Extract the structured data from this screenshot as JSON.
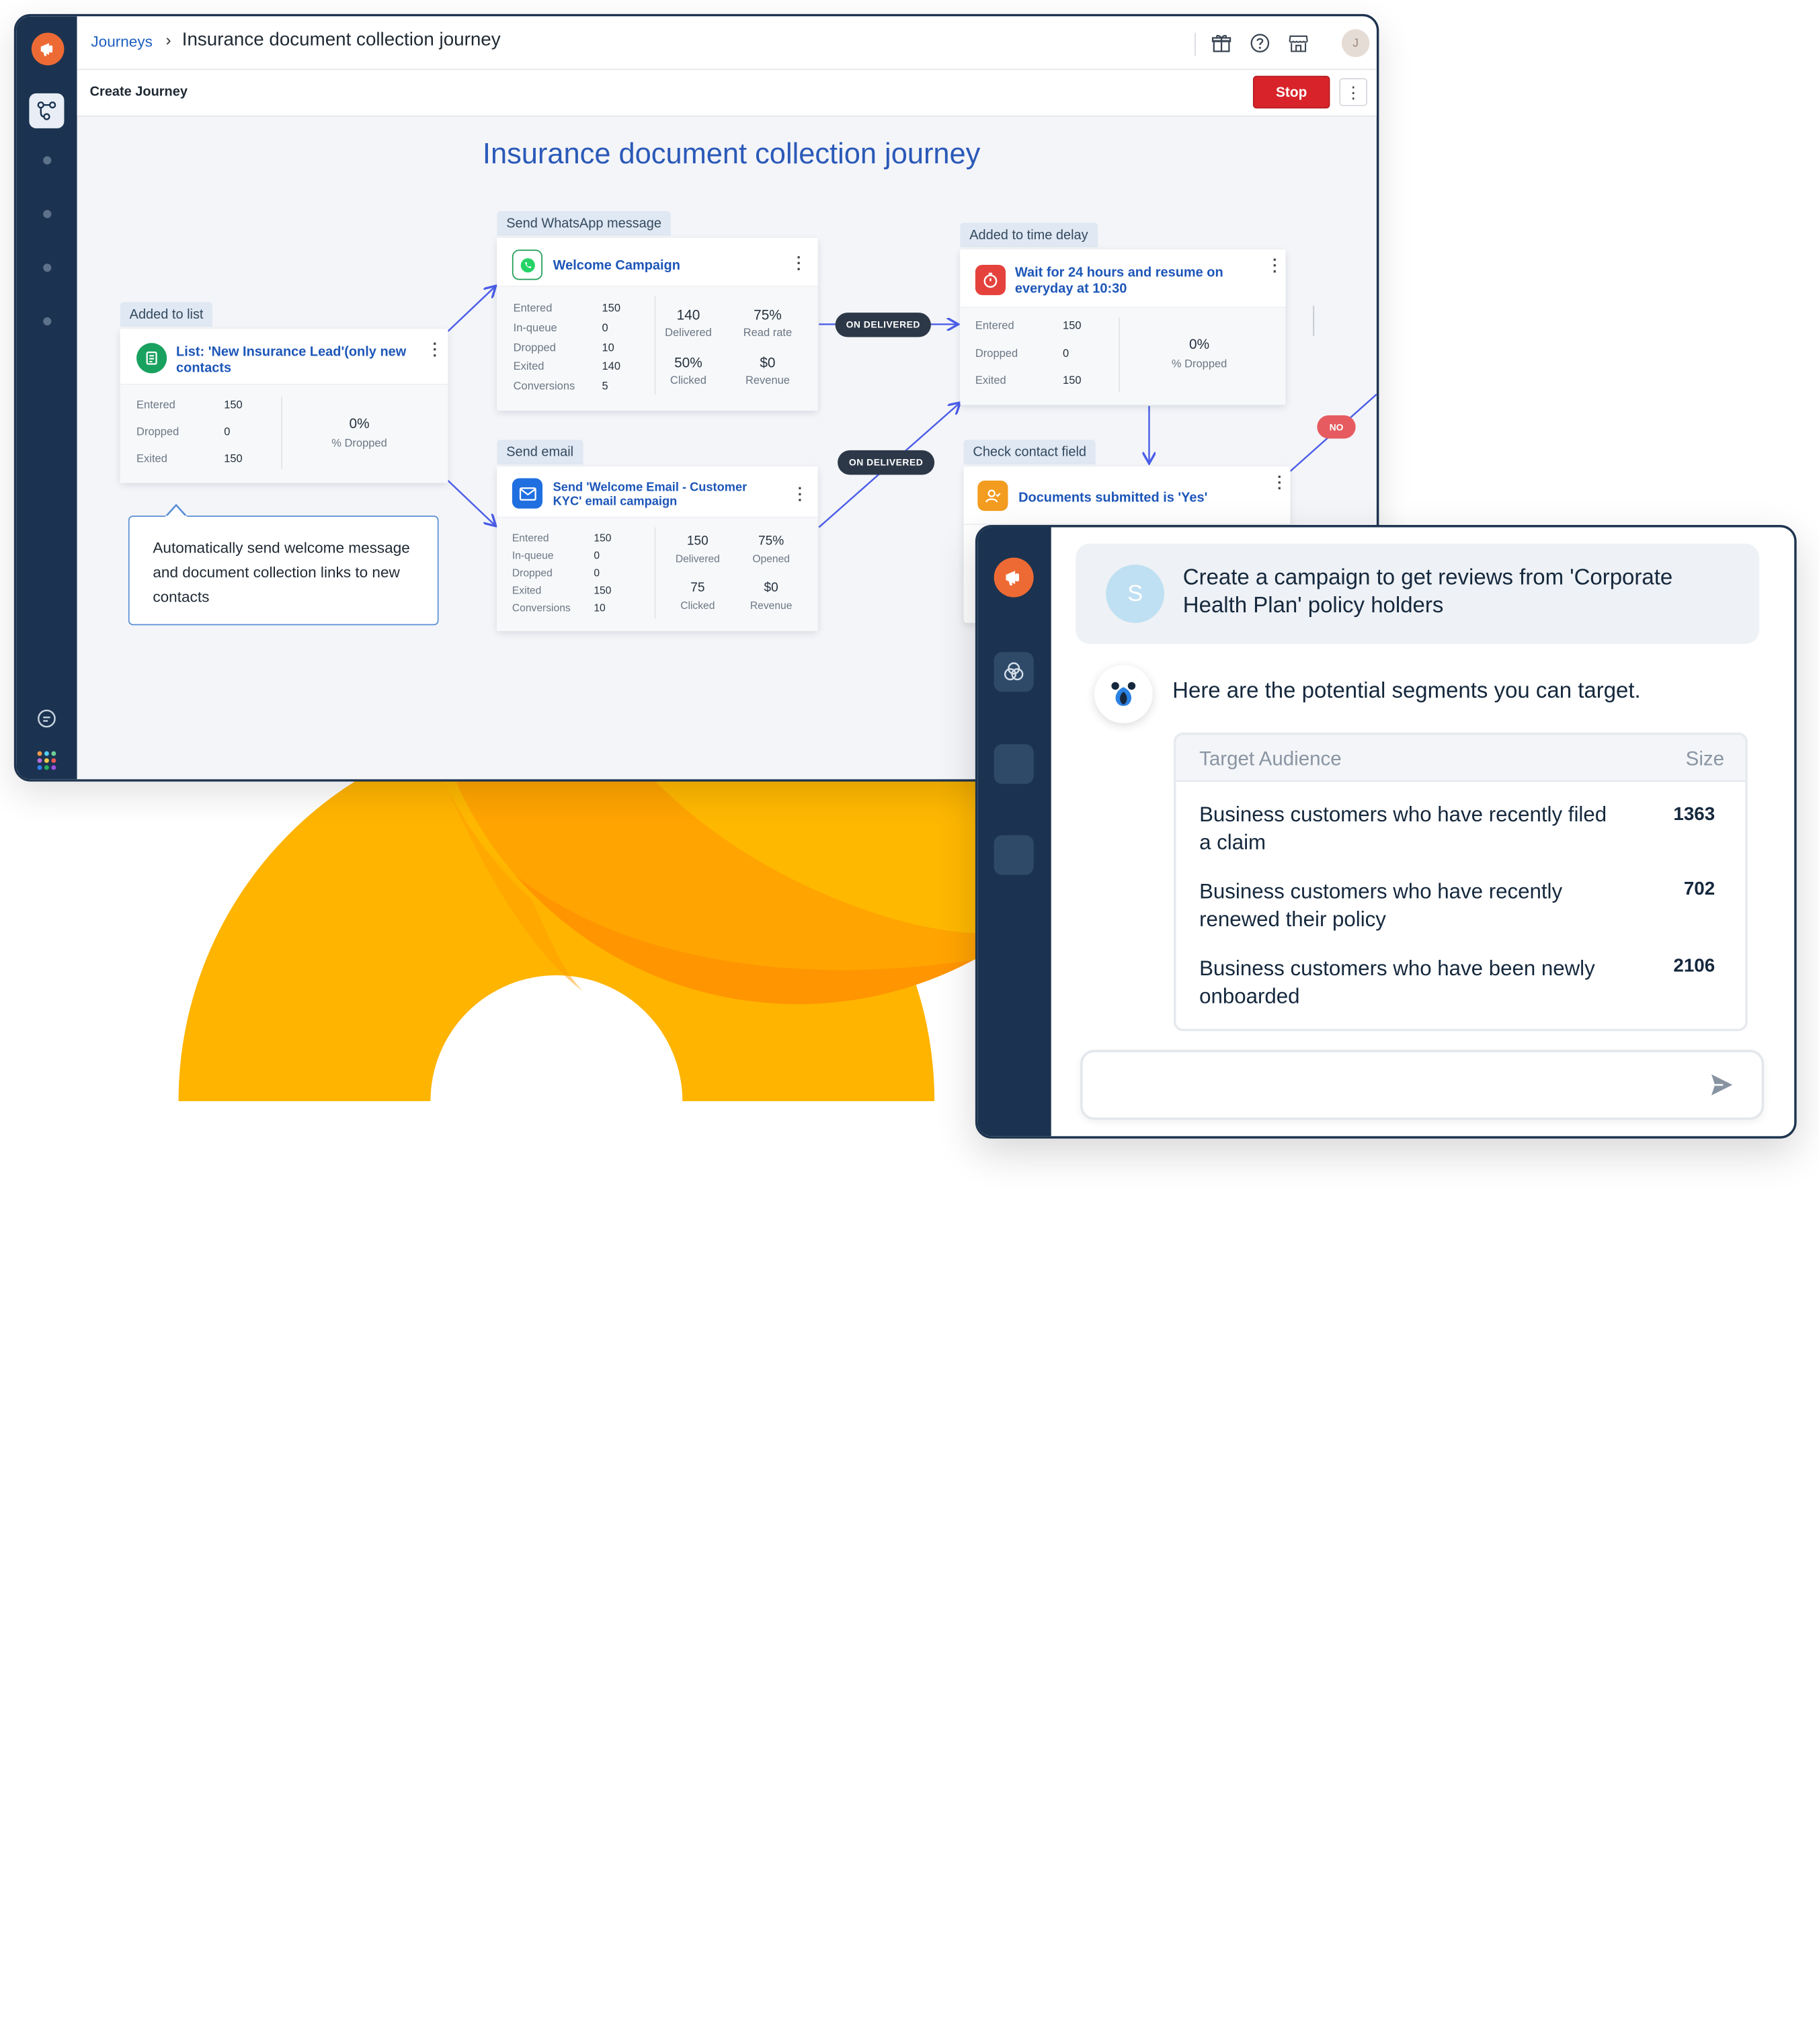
{
  "journey": {
    "breadcrumb_root": "Journeys",
    "breadcrumb_sep": "›",
    "breadcrumb_title": "Insurance document collection journey",
    "subbar_title": "Create Journey",
    "stop_label": "Stop",
    "avatar_initial": "J",
    "canvas_title": "Insurance document collection journey",
    "icons": [
      "gift-icon",
      "help-icon",
      "store-icon"
    ],
    "nodes": {
      "list": {
        "tag": "Added to list",
        "title_line1": "List: 'New Insurance Lead'(only new",
        "title_line2": "contacts",
        "stats": [
          {
            "label": "Entered",
            "value": "150"
          },
          {
            "label": "Dropped",
            "value": "0"
          },
          {
            "label": "Exited",
            "value": "150"
          }
        ],
        "metric_value": "0%",
        "metric_label": "% Dropped"
      },
      "whatsapp": {
        "tag": "Send WhatsApp message",
        "title": "Welcome Campaign",
        "stats": [
          {
            "label": "Entered",
            "value": "150"
          },
          {
            "label": "In-queue",
            "value": "0"
          },
          {
            "label": "Dropped",
            "value": "10"
          },
          {
            "label": "Exited",
            "value": "140"
          },
          {
            "label": "Conversions",
            "value": "5"
          }
        ],
        "metrics": [
          {
            "value": "140",
            "label": "Delivered"
          },
          {
            "value": "75%",
            "label": "Read rate"
          },
          {
            "value": "50%",
            "label": "Clicked"
          },
          {
            "value": "$0",
            "label": "Revenue"
          }
        ]
      },
      "email": {
        "tag": "Send email",
        "title_line1": "Send 'Welcome Email - Customer",
        "title_line2": "KYC' email campaign",
        "stats": [
          {
            "label": "Entered",
            "value": "150"
          },
          {
            "label": "In-queue",
            "value": "0"
          },
          {
            "label": "Dropped",
            "value": "0"
          },
          {
            "label": "Exited",
            "value": "150"
          },
          {
            "label": "Conversions",
            "value": "10"
          }
        ],
        "metrics": [
          {
            "value": "150",
            "label": "Delivered"
          },
          {
            "value": "75%",
            "label": "Opened"
          },
          {
            "value": "75",
            "label": "Clicked"
          },
          {
            "value": "$0",
            "label": "Revenue"
          }
        ]
      },
      "delay": {
        "tag": "Added to time delay",
        "title_line1": "Wait for 24 hours and resume on",
        "title_line2": "everyday at 10:30",
        "stats": [
          {
            "label": "Entered",
            "value": "150"
          },
          {
            "label": "Dropped",
            "value": "0"
          },
          {
            "label": "Exited",
            "value": "150"
          }
        ],
        "metric_value": "0%",
        "metric_label": "% Dropped"
      },
      "check": {
        "tag": "Check contact field",
        "title": "Documents submitted is 'Yes'"
      }
    },
    "pills": {
      "delivered_1": "ON DELIVERED",
      "delivered_2": "ON DELIVERED",
      "no": "NO"
    },
    "note": "Automatically send welcome message and document collection links to new contacts"
  },
  "chat": {
    "user_initial": "S",
    "user_message": "Create a campaign to get reviews from 'Corporate Health Plan' policy holders",
    "bot_message": "Here are the potential segments you can target.",
    "table_header_audience": "Target Audience",
    "table_header_size": "Size",
    "segments": [
      {
        "name": "Business customers who have recently filed a claim",
        "size": "1363"
      },
      {
        "name": "Business customers who have recently renewed their policy",
        "size": "702"
      },
      {
        "name": "Business customers who have been newly onboarded",
        "size": "2106"
      }
    ],
    "input_value": ""
  },
  "colors": {
    "sidebar": "#1b3350",
    "brand_orange": "#ee6a34",
    "accent_blue": "#2a59b8",
    "stop_red": "#d8232a",
    "deco_yellow": "#ffb400",
    "deco_orange": "#ff8c00"
  }
}
